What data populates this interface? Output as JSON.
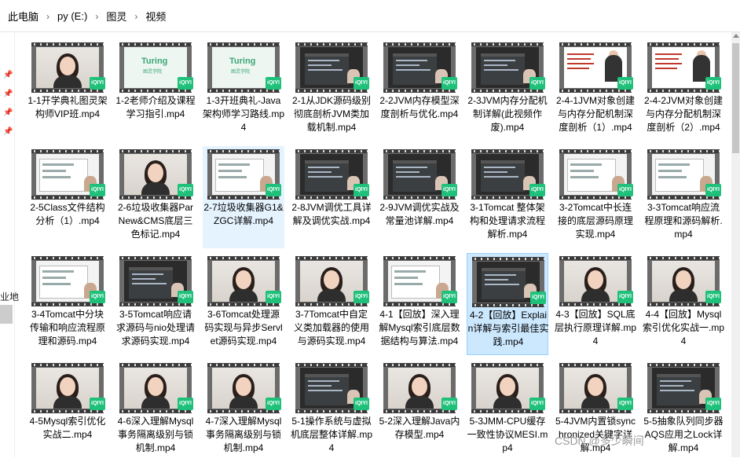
{
  "breadcrumbs": [
    "此电脑",
    "py (E:)",
    "图灵",
    "视频"
  ],
  "separator": "›",
  "left_pane": {
    "label": "业地"
  },
  "badge_text": "iQIYI",
  "files": [
    {
      "name": "1-1开学典礼图灵架构师VIP班.mp4",
      "thumb": "person"
    },
    {
      "name": "1-2老师介绍及课程学习指引.mp4",
      "thumb": "logo"
    },
    {
      "name": "1-3开班典礼-Java架构师学习路线.mp4",
      "thumb": "logo"
    },
    {
      "name": "2-1从JDK源码级别彻底剖析JVM类加载机制.mp4",
      "thumb": "code"
    },
    {
      "name": "2-2JVM内存模型深度剖析与优化.mp4",
      "thumb": "code"
    },
    {
      "name": "2-3JVM内存分配机制详解(此视频作废).mp4",
      "thumb": "code"
    },
    {
      "name": "2-4-1JVM对象创建与内存分配机制深度剖析（1）.mp4",
      "thumb": "poster"
    },
    {
      "name": "2-4-2JVM对象创建与内存分配机制深度剖析（2）.mp4",
      "thumb": "poster"
    },
    {
      "name": "2-5Class文件结构分析（1）.mp4",
      "thumb": "light"
    },
    {
      "name": "2-6垃圾收集器ParNew&CMS底层三色标记.mp4",
      "thumb": "person"
    },
    {
      "name": "2-7垃圾收集器G1&ZGC详解.mp4",
      "thumb": "light"
    },
    {
      "name": "2-8JVM调优工具详解及调优实战.mp4",
      "thumb": "code"
    },
    {
      "name": "2-9JVM调优实战及常量池详解.mp4",
      "thumb": "code"
    },
    {
      "name": "3-1Tomcat 整体架构和处理请求流程解析.mp4",
      "thumb": "code"
    },
    {
      "name": "3-2Tomcat中长连接的底层源码原理实现.mp4",
      "thumb": "light"
    },
    {
      "name": "3-3Tomcat响应流程原理和源码解析.mp4",
      "thumb": "light"
    },
    {
      "name": "3-4Tomcat中分块传输和响应流程原理和源码.mp4",
      "thumb": "light"
    },
    {
      "name": "3-5Tomcat响应请求源码与nio处理请求源码实现.mp4",
      "thumb": "code"
    },
    {
      "name": "3-6Tomcat处理源码实现与异步Servlet源码实现.mp4",
      "thumb": "person"
    },
    {
      "name": "3-7Tomcat中自定义类加载器的使用与源码实现.mp4",
      "thumb": "person"
    },
    {
      "name": "4-1【回放】深入理解Mysql索引底层数据结构与算法.mp4",
      "thumb": "light"
    },
    {
      "name": "4-2【回放】Explain详解与索引最佳实践.mp4",
      "thumb": "code"
    },
    {
      "name": "4-3【回放】SQL底层执行原理详解.mp4",
      "thumb": "person"
    },
    {
      "name": "4-4【回放】Mysql索引优化实战一.mp4",
      "thumb": "person"
    },
    {
      "name": "4-5Mysql索引优化实战二.mp4",
      "thumb": "person"
    },
    {
      "name": "4-6深入理解Mysql事务隔离级别与锁机制.mp4",
      "thumb": "person"
    },
    {
      "name": "4-7深入理解Mysql事务隔离级别与锁机制.mp4",
      "thumb": "person"
    },
    {
      "name": "5-1操作系统与虚拟机底层整体详解.mp4",
      "thumb": "code"
    },
    {
      "name": "5-2深入理解Java内存模型.mp4",
      "thumb": "person"
    },
    {
      "name": "5-3JMM-CPU缓存一致性协议MESI.mp4",
      "thumb": "person"
    },
    {
      "name": "5-4JVM内置锁synchronized关键字详解.mp4",
      "thumb": "person"
    },
    {
      "name": "5-5抽象队列同步器AQS应用之Lock详解.mp4",
      "thumb": "code"
    }
  ],
  "selected_index": 21,
  "hover_index": 10,
  "watermark": "CSDN @多少瞬间"
}
